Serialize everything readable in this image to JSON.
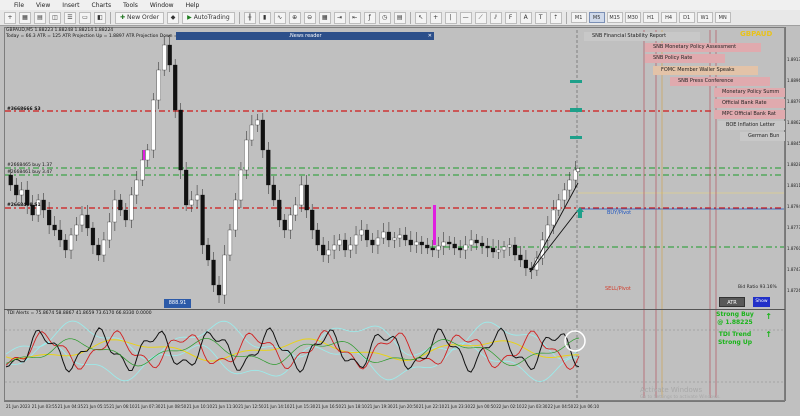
{
  "menu": [
    "File",
    "View",
    "Insert",
    "Charts",
    "Tools",
    "Window",
    "Help"
  ],
  "toolbar": {
    "new_order": "New Order",
    "autotrading": "AutoTrading",
    "timeframes": [
      "M1",
      "M5",
      "M15",
      "M30",
      "H1",
      "H4",
      "D1",
      "W1",
      "MN"
    ],
    "active_timeframe": "M5"
  },
  "chart": {
    "header_line1": "GBPAUD,M5  1.88223 1.88248 1.88214 1.88224",
    "header_line2": "Today = 66.3    ATR = 125    ATR Projection Up = 1.8897    ATR Projection Down = 1.8855",
    "symbol": "GBPAUD",
    "news_reader_title": ".News reader",
    "current_price_box": "888.91",
    "buy_pivot": "BUY/Pivot",
    "sell_pivot": "SELL/Pivot",
    "bid_ratio": "Bid Ratio 93.16%",
    "atr_button": "ATR",
    "show_button": "Show",
    "level_labels": {
      "top_red": "#3668666 S3",
      "green1": "#2668465 buy 1.37",
      "green2": "#2668461 buy 3.47",
      "mid_red": "#2668408 S1"
    },
    "price_ticks": [
      "1.89135",
      "1.88965",
      "1.88795",
      "1.88625",
      "1.88455",
      "1.88285",
      "1.88115",
      "1.87945",
      "1.87775",
      "1.87605",
      "1.87435",
      "1.87265"
    ],
    "time_ticks": [
      "21 Jun 2023",
      "21 Jun 03:55",
      "21 Jun 04:35",
      "21 Jun 05:15",
      "21 Jun 06:10",
      "21 Jun 07:30",
      "21 Jun 08:50",
      "21 Jun 10:10",
      "21 Jun 11:30",
      "21 Jun 12:50",
      "21 Jun 14:10",
      "21 Jun 15:30",
      "21 Jun 16:50",
      "21 Jun 18:10",
      "21 Jun 19:30",
      "21 Jun 20:50",
      "21 Jun 22:10",
      "21 Jun 23:30",
      "22 Jun 00:50",
      "22 Jun 02:10",
      "22 Jun 03:30",
      "22 Jun 04:50",
      "22 Jun 06:10"
    ]
  },
  "news_items": [
    {
      "label": "SNB Financial Stability Report",
      "style": "gray"
    },
    {
      "label": "SNB Monetary Policy Assessment",
      "style": "red"
    },
    {
      "label": "SNB Policy Rate",
      "style": "red"
    },
    {
      "label": "FOMC Member Waller Speaks",
      "style": "orange"
    },
    {
      "label": "SNB Press Conference",
      "style": "red"
    },
    {
      "label": "Monetary Policy Summ",
      "style": "red"
    },
    {
      "label": "Official Bank Rate",
      "style": "red"
    },
    {
      "label": "MPC Official Bank Rat",
      "style": "red"
    },
    {
      "label": "BOE Inflation Letter",
      "style": "gray"
    },
    {
      "label": "German Bun",
      "style": "gray"
    }
  ],
  "oscillator": {
    "label": "TDI Alerts = 75.8674 58.8867 41.8659 73.6170 66.8330 0.0000",
    "signal_line1": "Strong Buy",
    "signal_line2": "@ 1.88225",
    "signal_line3": "TDI Trend",
    "signal_line4": "Strong Up"
  },
  "watermark": {
    "line1": "Activate Windows",
    "line2": "Go to Settings to activate Windows."
  },
  "colors": {
    "red_level": "#d01818",
    "green_level": "#1d9d2a",
    "news_red": "#e0aaae",
    "signal_green": "#18b418"
  }
}
